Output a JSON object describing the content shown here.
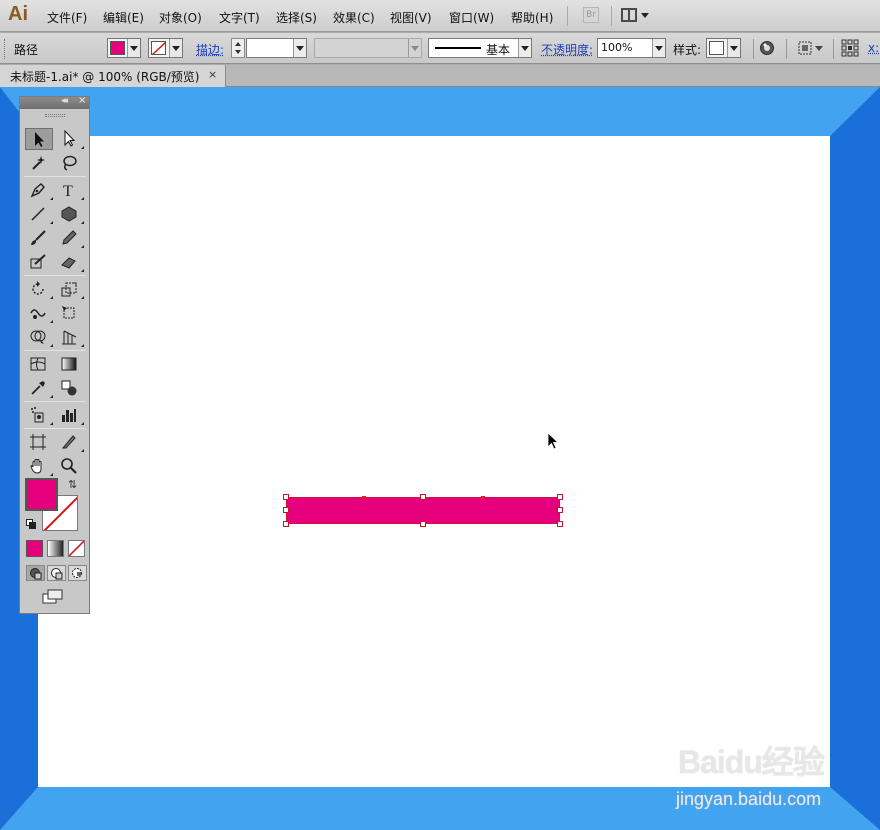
{
  "app": {
    "logo": "Ai"
  },
  "menu": {
    "items": [
      "文件(F)",
      "编辑(E)",
      "对象(O)",
      "文字(T)",
      "选择(S)",
      "效果(C)",
      "视图(V)",
      "窗口(W)",
      "帮助(H)"
    ],
    "bridge_label": "Br"
  },
  "control_bar": {
    "object_type": "路径",
    "stroke_label": "描边:",
    "stroke_profile": "基本",
    "opacity_label": "不透明度:",
    "opacity_value": "100%",
    "style_label": "样式:",
    "x_label": "x:"
  },
  "colors": {
    "fill": "#e6007e",
    "selection": "#cc1436",
    "canvas_blue": "#1a6fd8"
  },
  "document": {
    "tab_title": "未标题-1.ai* @ 100% (RGB/预览)",
    "tab_close": "×"
  },
  "tools_panel": {
    "collapse_glyph": "◂◂",
    "close_glyph": "×",
    "swap_glyph": "⇅"
  },
  "watermark": {
    "brand": "Baidu经验",
    "url": "jingyan.baidu.com"
  }
}
